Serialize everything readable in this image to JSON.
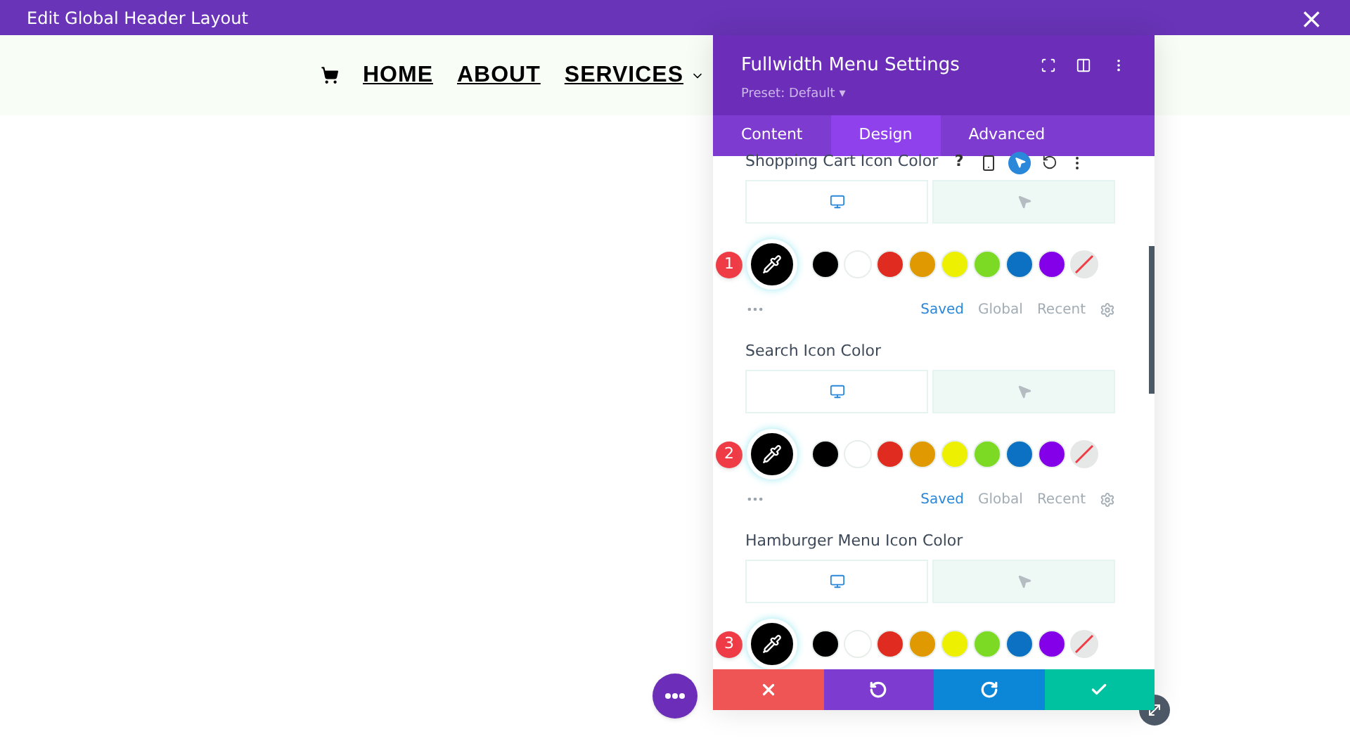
{
  "window": {
    "title": "Edit Global Header Layout",
    "close": "×"
  },
  "nav": {
    "items": [
      {
        "label": "HOME",
        "has_dropdown": false
      },
      {
        "label": "ABOUT",
        "has_dropdown": false
      },
      {
        "label": "SERVICES",
        "has_dropdown": true
      }
    ]
  },
  "panel": {
    "title": "Fullwidth Menu Settings",
    "preset": "Preset: Default",
    "preset_caret": "▾",
    "tabs": [
      {
        "label": "Content",
        "selected": false
      },
      {
        "label": "Design",
        "selected": true
      },
      {
        "label": "Advanced",
        "selected": false
      }
    ],
    "swatches": [
      {
        "color": "#000000"
      },
      {
        "color": "#ffffff"
      },
      {
        "color": "#e02b20"
      },
      {
        "color": "#e09900"
      },
      {
        "color": "#edf000"
      },
      {
        "color": "#7cda24"
      },
      {
        "color": "#0c71c3"
      },
      {
        "color": "#8300e9"
      },
      {
        "kind": "none"
      }
    ],
    "sections": [
      {
        "label": "Shopping Cart Icon Color",
        "toolbar": "?",
        "badge": "1",
        "state_tabs": [
          {
            "kind": "desktop",
            "selected": true
          },
          {
            "kind": "hover",
            "selected": false
          }
        ],
        "links": [
          {
            "label": "Saved",
            "selected": true
          },
          {
            "label": "Global",
            "selected": false
          },
          {
            "label": "Recent",
            "selected": false
          }
        ]
      },
      {
        "label": "Search Icon Color",
        "badge": "2",
        "state_tabs": [
          {
            "kind": "desktop",
            "selected": true
          },
          {
            "kind": "hover",
            "selected": false
          }
        ],
        "links": [
          {
            "label": "Saved",
            "selected": true
          },
          {
            "label": "Global",
            "selected": false
          },
          {
            "label": "Recent",
            "selected": false
          }
        ]
      },
      {
        "label": "Hamburger Menu Icon Color",
        "badge": "3",
        "state_tabs": [
          {
            "kind": "desktop",
            "selected": true
          },
          {
            "kind": "hover",
            "selected": false
          }
        ]
      }
    ],
    "footer": [
      {
        "kind": "cancel"
      },
      {
        "kind": "undo"
      },
      {
        "kind": "redo"
      },
      {
        "kind": "save"
      }
    ]
  }
}
